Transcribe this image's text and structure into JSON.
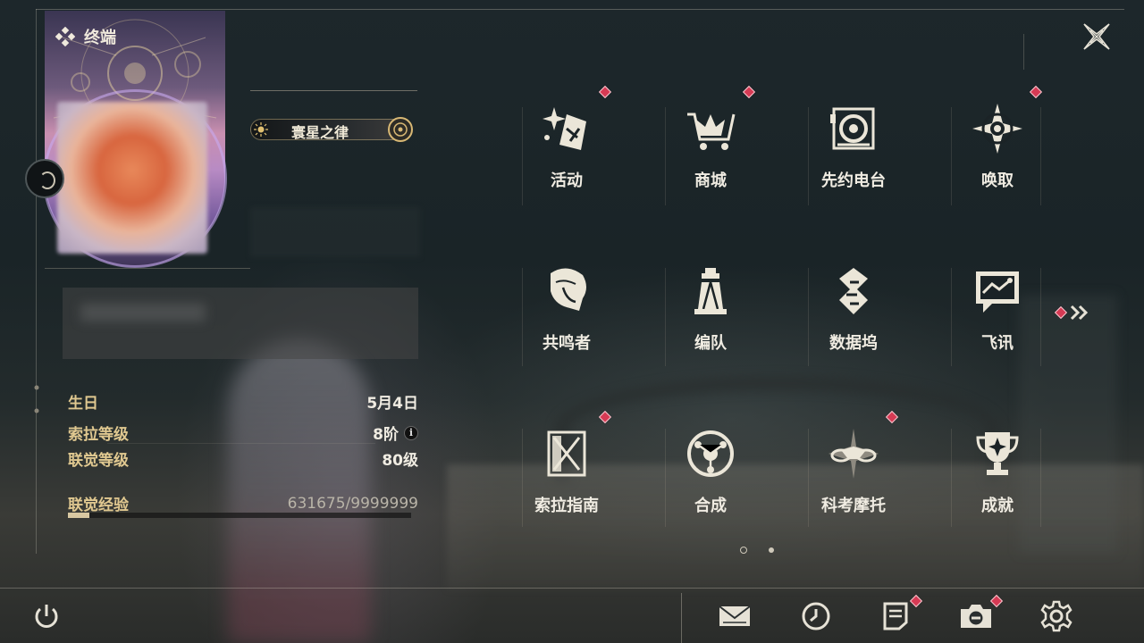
{
  "header": {
    "title": "终端"
  },
  "profile": {
    "title_badge": "寰星之律",
    "stats": [
      {
        "key": "生日",
        "value": "5月4日"
      },
      {
        "key": "索拉等级",
        "value": "8阶"
      },
      {
        "key": "联觉等级",
        "value": "80级"
      },
      {
        "key": "联觉经验",
        "value": "631675/9999999"
      }
    ],
    "exp_current": 631675,
    "exp_max": 9999999
  },
  "menu": {
    "items": [
      {
        "label": "活动",
        "icon": "activity-sparkle-icon",
        "badge": true
      },
      {
        "label": "商城",
        "icon": "shop-cart-icon",
        "badge": true
      },
      {
        "label": "先约电台",
        "icon": "radio-station-icon",
        "badge": false
      },
      {
        "label": "唤取",
        "icon": "compass-star-icon",
        "badge": true
      },
      {
        "label": "共鸣者",
        "icon": "resonator-portrait-icon",
        "badge": false
      },
      {
        "label": "编队",
        "icon": "chess-team-icon",
        "badge": false
      },
      {
        "label": "数据坞",
        "icon": "data-bank-icon",
        "badge": false
      },
      {
        "label": "飞讯",
        "icon": "message-chat-icon",
        "badge": false
      },
      {
        "label": "索拉指南",
        "icon": "guide-book-icon",
        "badge": true
      },
      {
        "label": "合成",
        "icon": "synthesis-orb-icon",
        "badge": false
      },
      {
        "label": "科考摩托",
        "icon": "research-motorbike-icon",
        "badge": true
      },
      {
        "label": "成就",
        "icon": "achievement-trophy-icon",
        "badge": false
      }
    ],
    "page": 1,
    "page_count": 2
  },
  "bottom_bar": {
    "icons": [
      "power-icon",
      "mail-icon",
      "clock-icon",
      "notice-icon",
      "camera-icon",
      "settings-icon"
    ],
    "badged": [
      "notice-icon",
      "camera-icon"
    ]
  },
  "colors": {
    "accent_gold": "#e0c890",
    "badge_red": "#d63a54",
    "text_light": "#f0ece2"
  }
}
